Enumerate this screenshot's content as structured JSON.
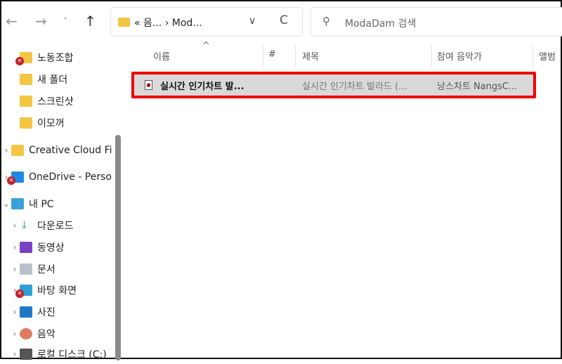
{
  "toolbar": {
    "back": "←",
    "forward": "→",
    "recent": "˅",
    "up": "↑",
    "refresh": "C"
  },
  "address": {
    "prefix": "«",
    "part1": "음...",
    "sep": "›",
    "part2": "Mod...",
    "dropdown": "∨"
  },
  "search": {
    "placeholder": "ModaDam 검색"
  },
  "sidebar": {
    "items": [
      {
        "label": "노동조합",
        "error": true
      },
      {
        "label": "새 폴더"
      },
      {
        "label": "스크린샷"
      },
      {
        "label": "이모꺼"
      },
      {
        "label": "Creative Cloud Fi"
      },
      {
        "label": "OneDrive - Perso",
        "error": true
      },
      {
        "label": "내 PC"
      },
      {
        "label": "다운로드"
      },
      {
        "label": "동영상"
      },
      {
        "label": "문서"
      },
      {
        "label": "바탕 화면",
        "error": true
      },
      {
        "label": "사진"
      },
      {
        "label": "음악"
      },
      {
        "label": "로컬 디스크 (C:)"
      }
    ]
  },
  "columns": {
    "name": "이름",
    "number": "#",
    "title": "제목",
    "artist": "참여 음악가",
    "album": "앨범",
    "sort": "^"
  },
  "files": [
    {
      "name": "실시간 인기차트 발...",
      "title": "실시간 인기차트 발라드 (...",
      "artist": "낭스차트 NangsC..."
    }
  ],
  "colors": {
    "highlight": "#e00000",
    "selected": "#d9d9d9"
  }
}
